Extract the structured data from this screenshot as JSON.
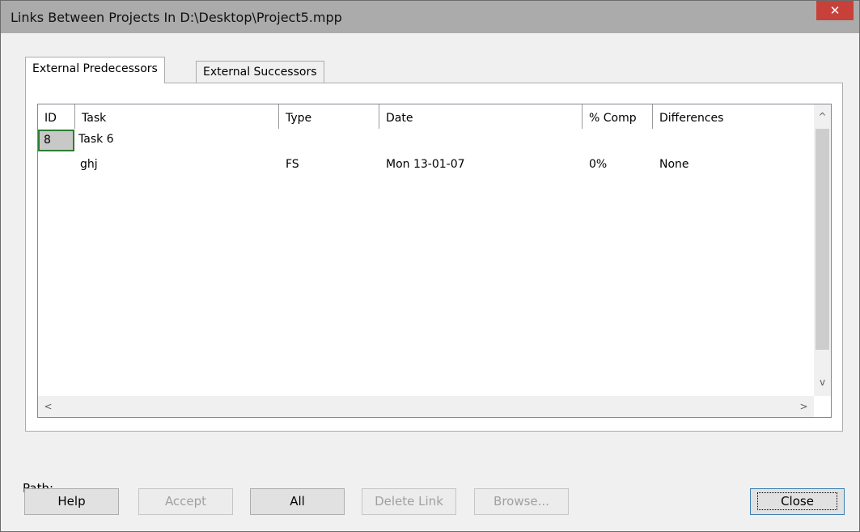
{
  "window": {
    "title": "Links Between Projects In D:\\Desktop\\Project5.mpp",
    "close_glyph": "✕"
  },
  "tabs": [
    {
      "label": "External Predecessors",
      "active": true
    },
    {
      "label": "External Successors",
      "active": false
    }
  ],
  "table": {
    "columns": [
      "ID",
      "Task",
      "Type",
      "Date",
      "% Comp",
      "Differences"
    ],
    "rows": [
      {
        "id": "8",
        "task": "Task 6",
        "type": "",
        "date": "",
        "comp": "",
        "diff": ""
      },
      {
        "id": "",
        "task": "ghj",
        "type": "FS",
        "date": "Mon 13-01-07",
        "comp": "0%",
        "diff": "None"
      }
    ]
  },
  "scroll": {
    "up": "^",
    "down": "v",
    "left": "<",
    "right": ">"
  },
  "path_label": "Path:",
  "buttons": {
    "help": "Help",
    "accept": "Accept",
    "all": "All",
    "delete_link": "Delete Link",
    "browse": "Browse...",
    "close": "Close"
  }
}
